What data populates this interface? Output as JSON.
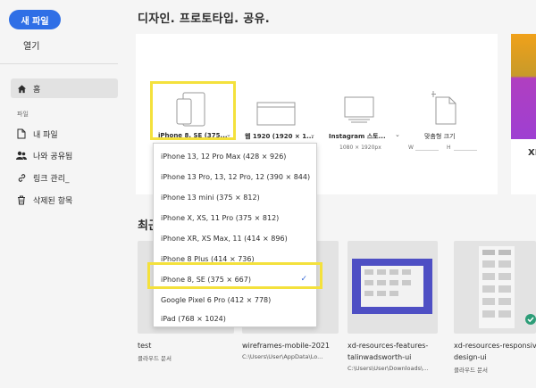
{
  "sidebar": {
    "new_file": "새 파일",
    "open": "열기",
    "home": "홈",
    "section_files": "파일",
    "my_files": "내 파일",
    "shared_with_me": "나와 공유됨",
    "manage_links": "링크 관리_",
    "deleted_items": "삭제된 항목"
  },
  "main": {
    "title": "디자인. 프로토타입. 공유.",
    "recent_title": "최근",
    "side_letter": "XI"
  },
  "presets": [
    {
      "label": "iPhone 8, SE (375...",
      "sub": ""
    },
    {
      "label": "웹 1920 (1920 × 1...",
      "sub": ""
    },
    {
      "label": "Instagram 스토...",
      "sub": "1080 × 1920px"
    },
    {
      "label": "맞춤형 크기",
      "sub_w": "W",
      "sub_h": "H"
    }
  ],
  "dropdown": {
    "items": [
      "iPhone 13, 12 Pro Max (428 × 926)",
      "iPhone 13 Pro, 13, 12 Pro, 12 (390 × 844)",
      "iPhone 13 mini (375 × 812)",
      "iPhone X, XS, 11 Pro (375 × 812)",
      "iPhone XR, XS Max, 11 (414 × 896)",
      "iPhone 8 Plus (414 × 736)",
      "iPhone 8, SE (375 × 667)",
      "Google Pixel 6 Pro (412 × 778)",
      "iPad (768 × 1024)"
    ],
    "selected": "iPhone 8, SE (375 × 667)",
    "check": "✓"
  },
  "files": [
    {
      "name": "test",
      "sub": "클라우드 문서"
    },
    {
      "name": "wireframes-mobile-2021",
      "sub": "C:\\Users\\User\\AppData\\Lo..."
    },
    {
      "name": "xd-resources-features-",
      "name2": "talinwadsworth-ui",
      "sub": "C:\\Users\\User\\Downloads\\..."
    },
    {
      "name": "xd-resources-responsiv",
      "name2": "design-ui",
      "sub": "클라우드 문서"
    }
  ]
}
